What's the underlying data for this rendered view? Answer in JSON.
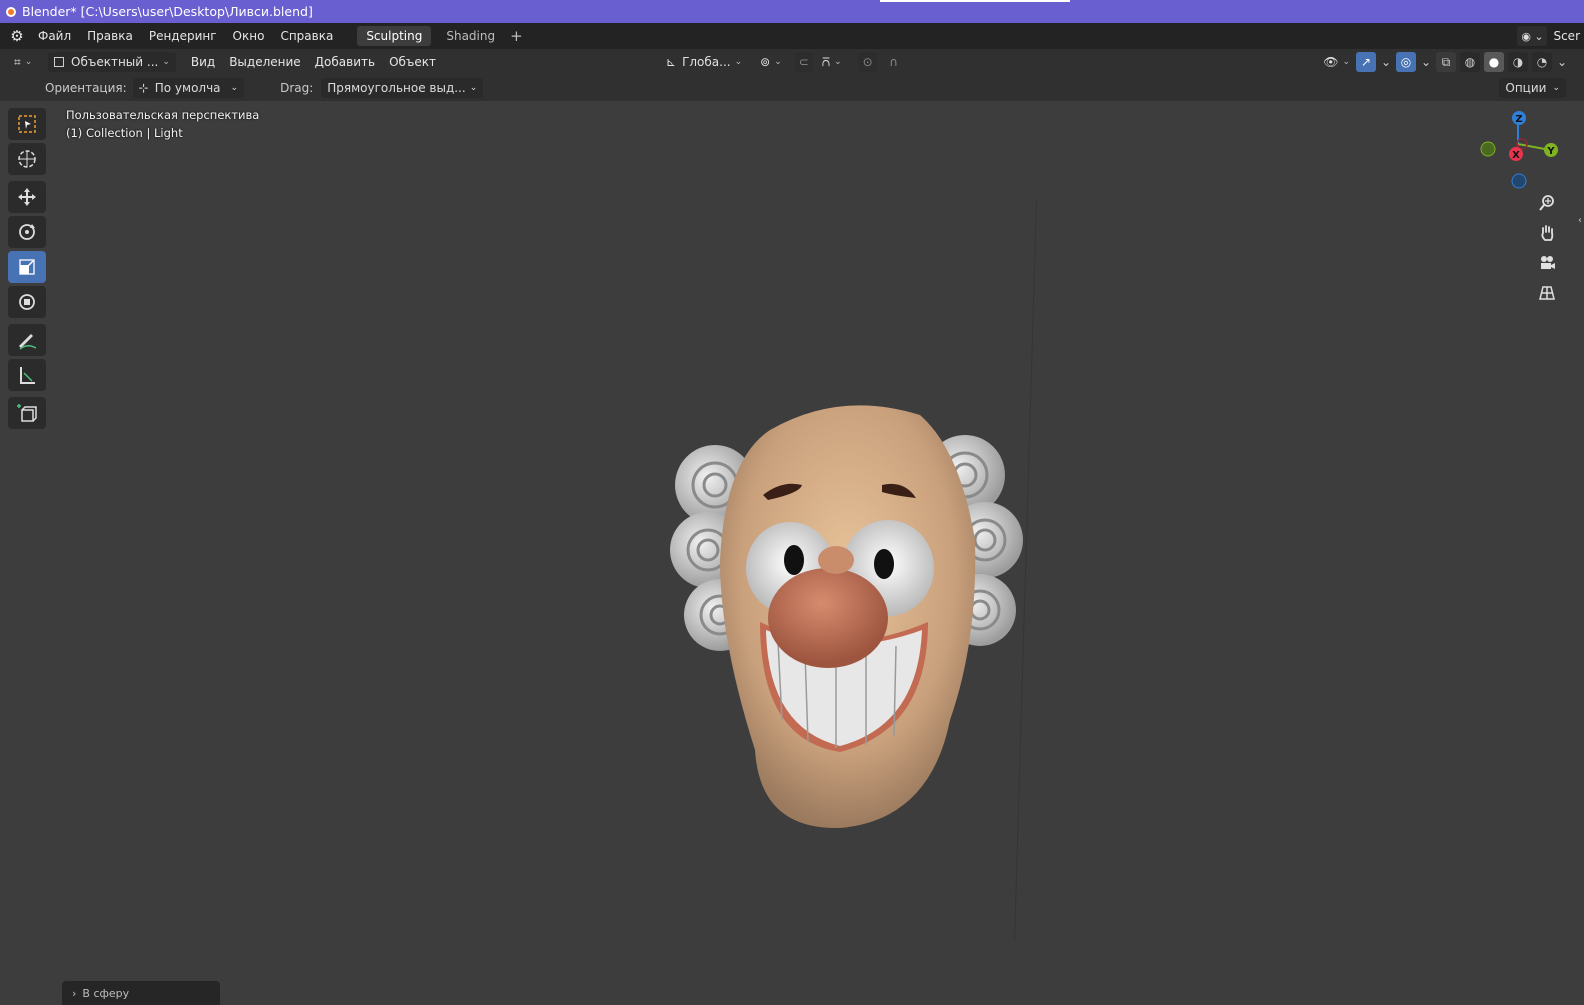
{
  "window": {
    "title": "Blender* [C:\\Users\\user\\Desktop\\Ливси.blend]"
  },
  "menubar": {
    "items": [
      "Файл",
      "Правка",
      "Рендеринг",
      "Окно",
      "Справка"
    ],
    "workspaces": [
      "Sculpting",
      "Shading"
    ],
    "active_workspace": "Sculpting",
    "add_workspace": "+",
    "scene_label": "Scer"
  },
  "viewport_header": {
    "mode": "Объектный ...",
    "menus": [
      "Вид",
      "Выделение",
      "Добавить",
      "Объект"
    ],
    "transform_orientation": "Глоба..."
  },
  "tool_settings": {
    "orientation_label": "Ориентация:",
    "orientation_value": "По умолча",
    "drag_label": "Drag:",
    "drag_value": "Прямоугольное выд...",
    "options_label": "Опции"
  },
  "viewport": {
    "view_name": "Пользовательская перспектива",
    "collection_info": "(1) Collection | Light"
  },
  "gizmo": {
    "z": "Z",
    "x": "X",
    "y": "Y",
    "colors": {
      "x": "#e8344f",
      "y": "#7fb321",
      "z": "#2f7fd8"
    }
  },
  "operator_panel": {
    "label": "В сферу"
  },
  "colors": {
    "titlebar": "#6a5fd0",
    "accent_blue": "#4772b3",
    "viewport_bg": "#3d3d3d"
  }
}
